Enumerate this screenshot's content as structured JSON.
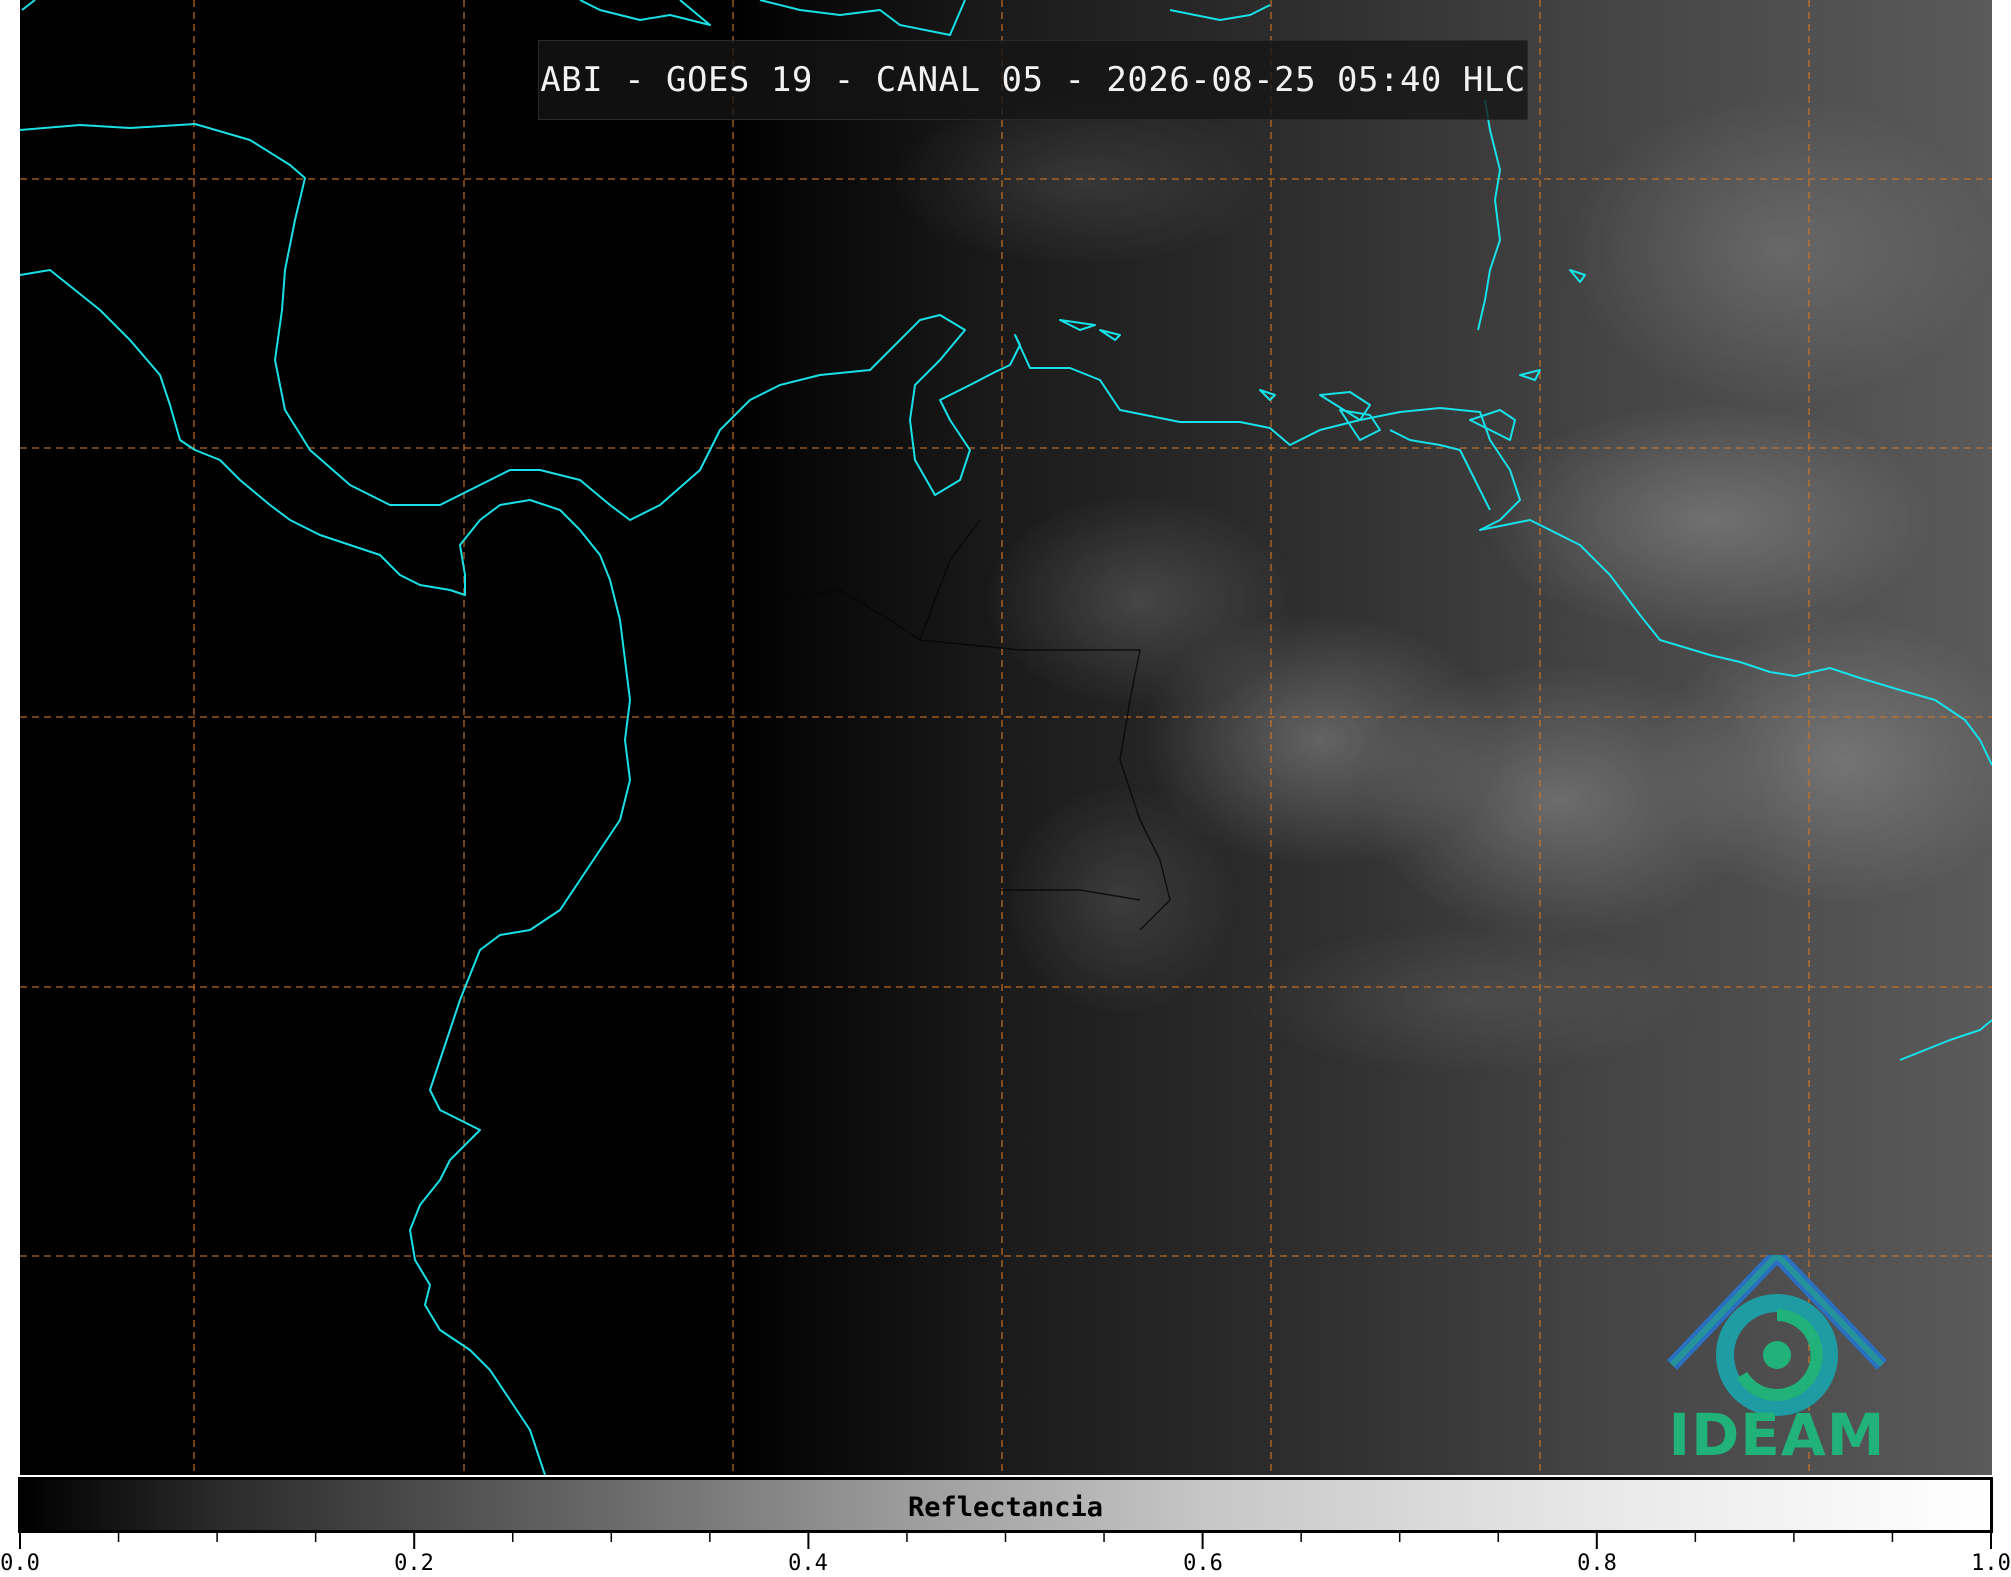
{
  "title": "ABI - GOES 19 - CANAL 05 - 2026-08-25 05:40 HLC",
  "colorbar": {
    "label": "Reflectancia",
    "range": [
      0.0,
      1.0
    ],
    "tick_labels": [
      "0.0",
      "0.2",
      "0.4",
      "0.6",
      "0.8",
      "1.0"
    ]
  },
  "logo": {
    "text": "IDEAM"
  },
  "colors": {
    "coastline": "#19e0e6",
    "graticule": "#d2772a",
    "logo_blue": "#2a6fc0",
    "logo_green": "#21b27a"
  }
}
